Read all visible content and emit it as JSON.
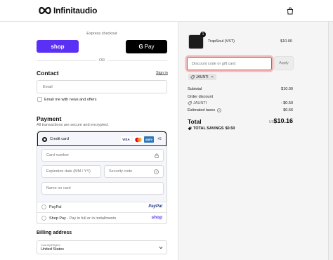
{
  "header": {
    "brand_name": "Infinitaudio",
    "cart_icon": "shopping-bag-icon"
  },
  "express": {
    "label": "Express checkout",
    "shop_label": "shop",
    "gpay_label": "Pay",
    "or_label": "OR"
  },
  "contact": {
    "title": "Contact",
    "signin_label": "Sign in",
    "email_placeholder": "Email",
    "newsletter_label": "Email me with news and offers"
  },
  "payment": {
    "title": "Payment",
    "subtitle": "All transactions are secure and encrypted.",
    "credit_card_label": "Credit card",
    "brands": [
      "VISA",
      "MC",
      "AMEX"
    ],
    "more_brands": "+5",
    "card_number_placeholder": "Card number",
    "expiration_placeholder": "Expiration date (MM / YY)",
    "security_code_placeholder": "Security code",
    "name_on_card_placeholder": "Name on card",
    "paypal_label": "PayPal",
    "paypal_logo": "PayPal",
    "shop_pay_label": "Shop Pay",
    "shop_pay_sub": "· Pay in full or in installments",
    "shop_pay_logo": "shop"
  },
  "billing": {
    "title": "Billing address",
    "country_label": "Country/Region",
    "country_value": "United States"
  },
  "order": {
    "product_name": "TrapSoul (VST)",
    "product_price": "$10.00",
    "quantity": "1",
    "discount_placeholder": "Discount code or gift card",
    "apply_label": "Apply",
    "applied_code": "JAUNTI",
    "subtotal_label": "Subtotal",
    "subtotal_value": "$10.00",
    "order_discount_label": "Order discount",
    "discount_code": "JAUNTI",
    "discount_value": "- $0.50",
    "taxes_label": "Estimated taxes",
    "taxes_value": "$0.66",
    "total_label": "Total",
    "currency": "USD",
    "total_value": "$10.16",
    "savings_label": "TOTAL SAVINGS",
    "savings_value": "$0.50"
  },
  "colors": {
    "shop_purple": "#5a31f4",
    "focus_red": "#e84c4c",
    "paypal_blue": "#253b80",
    "amex_blue": "#2e77bb"
  }
}
